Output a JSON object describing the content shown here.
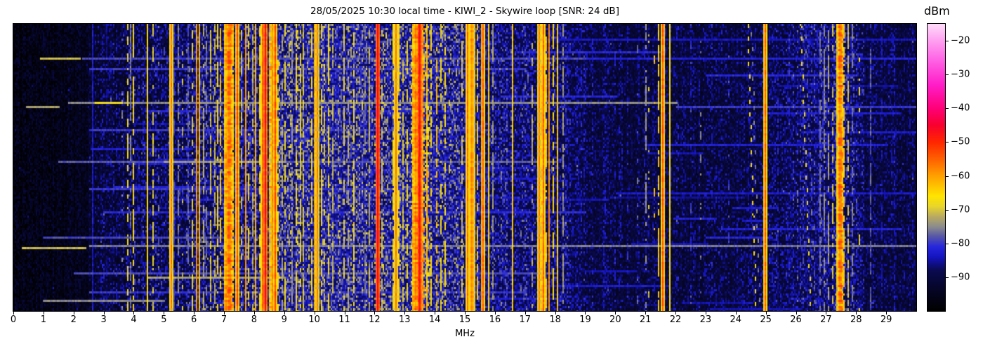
{
  "chart_data": {
    "type": "heatmap",
    "title": "28/05/2025 10:30 local time - KIWI_2 - Skywire loop [SNR: 24 dB]",
    "xlabel": "MHz",
    "xlim": [
      0,
      30
    ],
    "x_ticks": [
      0,
      1,
      2,
      3,
      4,
      5,
      6,
      7,
      8,
      9,
      10,
      11,
      12,
      13,
      14,
      15,
      16,
      17,
      18,
      19,
      20,
      21,
      22,
      23,
      24,
      25,
      26,
      27,
      28,
      29
    ],
    "grid": false,
    "legend_position": "none",
    "colorbar": {
      "label": "dBm",
      "ticks": [
        -20,
        -30,
        -40,
        -50,
        -60,
        -70,
        -80,
        -90
      ],
      "vmin": -100,
      "vmax": -15,
      "stops": [
        [
          -100,
          "#000000"
        ],
        [
          -93,
          "#06062a"
        ],
        [
          -88,
          "#0a0a50"
        ],
        [
          -84,
          "#1414c0"
        ],
        [
          -81,
          "#2626dd"
        ],
        [
          -78,
          "#5555a8"
        ],
        [
          -75,
          "#8c8c8c"
        ],
        [
          -72,
          "#b9ab60"
        ],
        [
          -69,
          "#e8d62a"
        ],
        [
          -66,
          "#ffe400"
        ],
        [
          -60,
          "#ffa000"
        ],
        [
          -55,
          "#ff6000"
        ],
        [
          -50,
          "#ff2600"
        ],
        [
          -45,
          "#f8002e"
        ],
        [
          -40,
          "#ff0078"
        ],
        [
          -33,
          "#ff1ec8"
        ],
        [
          -26,
          "#ff60e4"
        ],
        [
          -20,
          "#ff9ff0"
        ],
        [
          -15,
          "#ffdcfa"
        ]
      ]
    },
    "noise_floor_dbm_by_mhz": [
      [
        0,
        -99.5
      ],
      [
        1,
        -99
      ],
      [
        2,
        -98.5
      ],
      [
        2.6,
        -96.5
      ],
      [
        3,
        -95
      ],
      [
        4,
        -94
      ],
      [
        5,
        -93.5
      ],
      [
        6,
        -92.5
      ],
      [
        7,
        -91
      ],
      [
        7.5,
        -90.5
      ],
      [
        8,
        -90
      ],
      [
        9,
        -89
      ],
      [
        10,
        -88
      ],
      [
        11,
        -88
      ],
      [
        12,
        -88.5
      ],
      [
        13,
        -88
      ],
      [
        13.6,
        -87.5
      ],
      [
        14,
        -88.5
      ],
      [
        15,
        -89.5
      ],
      [
        16,
        -90.5
      ],
      [
        17,
        -91
      ],
      [
        18,
        -91.5
      ],
      [
        19,
        -93
      ],
      [
        20,
        -93.5
      ],
      [
        21,
        -93.5
      ],
      [
        22,
        -94
      ],
      [
        23,
        -94
      ],
      [
        24,
        -93.5
      ],
      [
        25,
        -93.5
      ],
      [
        26,
        -92
      ],
      [
        26.8,
        -91
      ],
      [
        27.6,
        -91
      ],
      [
        28.2,
        -93
      ],
      [
        29,
        -93.5
      ],
      [
        30,
        -94
      ]
    ],
    "noise_spread_db_by_mhz": [
      [
        0,
        8
      ],
      [
        2.4,
        8
      ],
      [
        2.6,
        12
      ],
      [
        8,
        15
      ],
      [
        9,
        17
      ],
      [
        14,
        17
      ],
      [
        16,
        14
      ],
      [
        18.5,
        12
      ],
      [
        19,
        10
      ],
      [
        24,
        10
      ],
      [
        26,
        13
      ],
      [
        28,
        13
      ],
      [
        28.3,
        10
      ],
      [
        30,
        9
      ]
    ],
    "signal_bands": [
      [
        2.62,
        1,
        -83,
        "s"
      ],
      [
        3.1,
        1,
        -87,
        "d"
      ],
      [
        3.62,
        1,
        -76,
        "i"
      ],
      [
        3.78,
        2,
        -68,
        "d"
      ],
      [
        3.88,
        1,
        -76,
        "d"
      ],
      [
        3.98,
        2,
        -66,
        "d"
      ],
      [
        4.18,
        1,
        -78,
        "i"
      ],
      [
        4.47,
        2,
        -66,
        "s"
      ],
      [
        4.63,
        1,
        -70,
        "d"
      ],
      [
        4.85,
        1,
        -76,
        "i"
      ],
      [
        5.0,
        1,
        -80,
        "i"
      ],
      [
        5.23,
        2,
        -57,
        "s"
      ],
      [
        5.33,
        1,
        -80,
        "d"
      ],
      [
        5.48,
        1,
        -75,
        "d"
      ],
      [
        5.62,
        1,
        -71,
        "i"
      ],
      [
        5.8,
        1,
        -78,
        "d"
      ],
      [
        5.95,
        2,
        -68,
        "d"
      ],
      [
        6.07,
        2,
        -60,
        "s"
      ],
      [
        6.2,
        2,
        -63,
        "s"
      ],
      [
        6.31,
        1,
        -72,
        "d"
      ],
      [
        6.42,
        1,
        -76,
        "d"
      ],
      [
        6.55,
        2,
        -70,
        "d"
      ],
      [
        6.7,
        1,
        -72,
        "d"
      ],
      [
        6.8,
        2,
        -66,
        "d"
      ],
      [
        6.9,
        2,
        -64,
        "d"
      ],
      [
        7.0,
        1,
        -68,
        "d"
      ],
      [
        7.08,
        3,
        -60,
        "b"
      ],
      [
        7.15,
        4,
        -56,
        "b"
      ],
      [
        7.22,
        3,
        -60,
        "b"
      ],
      [
        7.3,
        2,
        -66,
        "d"
      ],
      [
        7.44,
        2,
        -53,
        "s"
      ],
      [
        7.58,
        1,
        -70,
        "d"
      ],
      [
        7.7,
        2,
        -60,
        "s"
      ],
      [
        7.8,
        1,
        -68,
        "d"
      ],
      [
        7.95,
        1,
        -72,
        "d"
      ],
      [
        8.05,
        2,
        -62,
        "s"
      ],
      [
        8.17,
        1,
        -66,
        "d"
      ],
      [
        8.3,
        2,
        -55,
        "s"
      ],
      [
        8.38,
        2,
        -46,
        "s"
      ],
      [
        8.5,
        2,
        -62,
        "b"
      ],
      [
        8.6,
        2,
        -58,
        "s"
      ],
      [
        8.68,
        2,
        -53,
        "s"
      ],
      [
        8.78,
        1,
        -66,
        "d"
      ],
      [
        8.95,
        1,
        -72,
        "d"
      ],
      [
        9.05,
        2,
        -68,
        "d"
      ],
      [
        9.15,
        1,
        -70,
        "i"
      ],
      [
        9.28,
        1,
        -74,
        "d"
      ],
      [
        9.4,
        2,
        -66,
        "d"
      ],
      [
        9.52,
        1,
        -68,
        "d"
      ],
      [
        9.65,
        1,
        -70,
        "d"
      ],
      [
        9.78,
        1,
        -72,
        "i"
      ],
      [
        9.9,
        2,
        -67,
        "d"
      ],
      [
        10.03,
        2,
        -61,
        "s"
      ],
      [
        10.12,
        2,
        -58,
        "s"
      ],
      [
        10.22,
        1,
        -66,
        "d"
      ],
      [
        10.35,
        1,
        -70,
        "d"
      ],
      [
        10.48,
        2,
        -67,
        "d"
      ],
      [
        10.62,
        1,
        -72,
        "d"
      ],
      [
        10.8,
        1,
        -75,
        "i"
      ],
      [
        11.0,
        2,
        -69,
        "d"
      ],
      [
        11.15,
        1,
        -72,
        "d"
      ],
      [
        11.32,
        1,
        -68,
        "d"
      ],
      [
        11.5,
        1,
        -74,
        "i"
      ],
      [
        11.68,
        1,
        -76,
        "d"
      ],
      [
        11.85,
        1,
        -72,
        "d"
      ],
      [
        12.1,
        2,
        -44,
        "s"
      ],
      [
        12.25,
        1,
        -70,
        "d"
      ],
      [
        12.42,
        1,
        -73,
        "i"
      ],
      [
        12.6,
        1,
        -68,
        "d"
      ],
      [
        12.7,
        2,
        -57,
        "s"
      ],
      [
        12.82,
        1,
        -66,
        "d"
      ],
      [
        12.95,
        1,
        -70,
        "d"
      ],
      [
        13.1,
        1,
        -68,
        "d"
      ],
      [
        13.28,
        2,
        -62,
        "b"
      ],
      [
        13.38,
        3,
        -57,
        "b"
      ],
      [
        13.45,
        2,
        -52,
        "s"
      ],
      [
        13.52,
        2,
        -46,
        "s"
      ],
      [
        13.62,
        2,
        -60,
        "b"
      ],
      [
        13.75,
        2,
        -64,
        "b"
      ],
      [
        13.9,
        2,
        -66,
        "d"
      ],
      [
        14.05,
        2,
        -63,
        "d"
      ],
      [
        14.2,
        1,
        -68,
        "d"
      ],
      [
        14.35,
        1,
        -66,
        "d"
      ],
      [
        14.5,
        1,
        -70,
        "i"
      ],
      [
        14.7,
        1,
        -74,
        "i"
      ],
      [
        14.9,
        1,
        -70,
        "d"
      ],
      [
        15.1,
        1,
        -56,
        "s"
      ],
      [
        15.25,
        3,
        -58,
        "s"
      ],
      [
        15.4,
        2,
        -64,
        "d"
      ],
      [
        15.55,
        2,
        -62,
        "s"
      ],
      [
        15.62,
        2,
        -55,
        "s"
      ],
      [
        15.78,
        1,
        -65,
        "s"
      ],
      [
        15.95,
        1,
        -74,
        "d"
      ],
      [
        16.2,
        1,
        -76,
        "i"
      ],
      [
        16.6,
        2,
        -64,
        "s"
      ],
      [
        16.85,
        1,
        -78,
        "i"
      ],
      [
        17.1,
        1,
        -76,
        "i"
      ],
      [
        17.25,
        1,
        -72,
        "d"
      ],
      [
        17.45,
        2,
        -58,
        "s"
      ],
      [
        17.55,
        2,
        -62,
        "d"
      ],
      [
        17.62,
        2,
        -55,
        "s"
      ],
      [
        17.72,
        2,
        -63,
        "d"
      ],
      [
        17.82,
        2,
        -59,
        "s"
      ],
      [
        17.95,
        2,
        -66,
        "d"
      ],
      [
        18.07,
        2,
        -64,
        "s"
      ],
      [
        18.25,
        1,
        -74,
        "d"
      ],
      [
        18.5,
        1,
        -80,
        "i"
      ],
      [
        18.85,
        1,
        -82,
        "i"
      ],
      [
        19.2,
        1,
        -84,
        "i"
      ],
      [
        19.6,
        1,
        -83,
        "i"
      ],
      [
        20.0,
        1,
        -82,
        "i"
      ],
      [
        20.4,
        1,
        -80,
        "i"
      ],
      [
        20.75,
        1,
        -78,
        "i"
      ],
      [
        21.0,
        2,
        -74,
        "d"
      ],
      [
        21.12,
        1,
        -70,
        "i"
      ],
      [
        21.3,
        2,
        -63,
        "i"
      ],
      [
        21.45,
        1,
        -64,
        "d"
      ],
      [
        21.6,
        2,
        -54,
        "s"
      ],
      [
        21.8,
        1,
        -67,
        "s"
      ],
      [
        22.1,
        1,
        -82,
        "i"
      ],
      [
        22.5,
        1,
        -80,
        "i"
      ],
      [
        22.85,
        1,
        -76,
        "i"
      ],
      [
        23.2,
        1,
        -82,
        "i"
      ],
      [
        23.75,
        1,
        -80,
        "i"
      ],
      [
        25.0,
        2,
        -55,
        "s"
      ],
      [
        25.4,
        1,
        -82,
        "i"
      ],
      [
        25.8,
        1,
        -80,
        "i"
      ],
      [
        26.8,
        2,
        -77,
        "d"
      ],
      [
        26.95,
        2,
        -75,
        "d"
      ],
      [
        27.1,
        2,
        -73,
        "d"
      ],
      [
        27.22,
        1,
        -70,
        "d"
      ],
      [
        27.35,
        2,
        -66,
        "d"
      ],
      [
        27.45,
        3,
        -57,
        "b"
      ],
      [
        27.52,
        2,
        -60,
        "b"
      ],
      [
        27.62,
        2,
        -64,
        "d"
      ],
      [
        27.75,
        1,
        -70,
        "d"
      ],
      [
        27.9,
        1,
        -76,
        "d"
      ],
      [
        28.1,
        1,
        -68,
        "i"
      ],
      [
        28.5,
        1,
        -78,
        "d"
      ],
      [
        28.85,
        1,
        -84,
        "d"
      ],
      [
        29.3,
        1,
        -82,
        "i"
      ],
      [
        29.6,
        1,
        -85,
        "i"
      ]
    ],
    "horizontal_streaks": [
      [
        0.055,
        18,
        30,
        -84
      ],
      [
        0.115,
        2.3,
        19,
        -79
      ],
      [
        0.118,
        19,
        30,
        -82
      ],
      [
        0.12,
        0.9,
        2.2,
        -71
      ],
      [
        0.155,
        2.5,
        17,
        -80
      ],
      [
        0.18,
        23,
        28,
        -81
      ],
      [
        0.27,
        1.8,
        22,
        -75
      ],
      [
        0.272,
        2.7,
        3.6,
        -68
      ],
      [
        0.285,
        0.4,
        1.5,
        -73
      ],
      [
        0.29,
        22,
        30,
        -80
      ],
      [
        0.37,
        2.5,
        16,
        -80
      ],
      [
        0.42,
        21,
        29,
        -82
      ],
      [
        0.475,
        1.5,
        18,
        -78
      ],
      [
        0.48,
        5,
        9,
        -74
      ],
      [
        0.575,
        2.5,
        14,
        -80
      ],
      [
        0.59,
        20,
        30,
        -83
      ],
      [
        0.655,
        3,
        19,
        -81
      ],
      [
        0.71,
        23.5,
        29.5,
        -82
      ],
      [
        0.74,
        1,
        10,
        -79
      ],
      [
        0.775,
        2.5,
        30,
        -76
      ],
      [
        0.78,
        0.3,
        2.4,
        -71
      ],
      [
        0.87,
        2,
        18,
        -79
      ],
      [
        0.88,
        4.5,
        9,
        -73
      ],
      [
        0.935,
        2.5,
        17,
        -80
      ],
      [
        0.96,
        1,
        5,
        -75
      ]
    ],
    "diagonal_drifters": [
      {
        "f0": 24.38,
        "drift": 0.28,
        "lv": -67,
        "dash": 2,
        "period": 6
      },
      {
        "f0": 24.5,
        "drift": 0.28,
        "lv": -76,
        "dash": 2,
        "period": 7
      },
      {
        "f0": 26.15,
        "drift": 0.33,
        "lv": -68,
        "dash": 2,
        "period": 6
      },
      {
        "f0": 26.3,
        "drift": 0.33,
        "lv": -77,
        "dash": 2,
        "period": 7
      }
    ],
    "random_streak_count": 50,
    "seed": 1337
  }
}
